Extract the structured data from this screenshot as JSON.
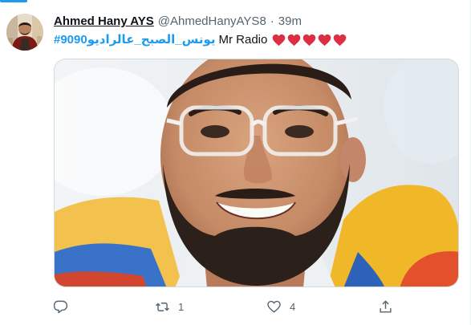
{
  "tweet": {
    "author_name": "Ahmed Hany AYS",
    "author_handle": "@AhmedHanyAYS8",
    "separator": "·",
    "timestamp": "39m",
    "hashtag": "#يونس_الصبح_عالراديو9090",
    "text": "Mr Radio",
    "emoji": [
      "heart-emoji",
      "heart-emoji",
      "heart-emoji",
      "heart-emoji",
      "heart-emoji"
    ],
    "media": {
      "type": "photo",
      "subject": "smiling man with glasses"
    }
  },
  "actions": {
    "reply": {
      "icon": "reply-icon",
      "count": ""
    },
    "retweet": {
      "icon": "retweet-icon",
      "count": "1"
    },
    "like": {
      "icon": "heart-icon",
      "count": "4"
    },
    "share": {
      "icon": "share-icon",
      "count": ""
    }
  },
  "colors": {
    "accent": "#1d9bf0",
    "text_primary": "#0f1419",
    "text_secondary": "#536471",
    "heart_red": "#dd2e44"
  }
}
